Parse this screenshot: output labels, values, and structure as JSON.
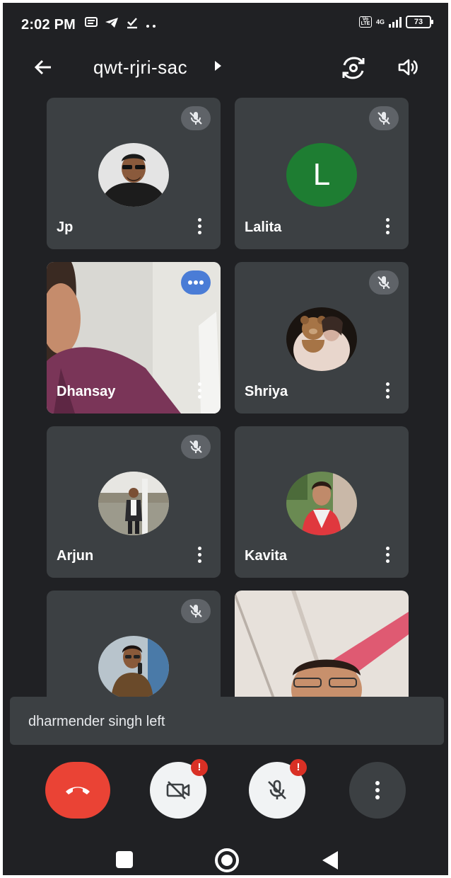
{
  "status_bar": {
    "time": "2:02 PM",
    "network": "4G",
    "battery": "73"
  },
  "header": {
    "meeting_code": "qwt-rjri-sac"
  },
  "participants": [
    {
      "name": "Jp",
      "muted": true,
      "avatar": "photo"
    },
    {
      "name": "Lalita",
      "muted": true,
      "avatar": "letter",
      "initial": "L"
    },
    {
      "name": "Dhansay",
      "muted": false,
      "avatar": "video",
      "status": "speaking"
    },
    {
      "name": "Shriya",
      "muted": true,
      "avatar": "photo"
    },
    {
      "name": "Arjun",
      "muted": true,
      "avatar": "photo"
    },
    {
      "name": "Kavita",
      "muted": false,
      "avatar": "photo"
    },
    {
      "name": "",
      "muted": true,
      "avatar": "photo"
    },
    {
      "name": "",
      "muted": false,
      "avatar": "video"
    }
  ],
  "toast": {
    "message": "dharmender singh left"
  },
  "controls": {
    "camera_badge": "!",
    "mic_badge": "!"
  },
  "colors": {
    "background": "#202124",
    "tile": "#3c4043",
    "hangup": "#ea4335",
    "lalita_avatar": "#1e7d32",
    "speaking_pill": "#4a7cd6",
    "alert": "#d93025"
  }
}
